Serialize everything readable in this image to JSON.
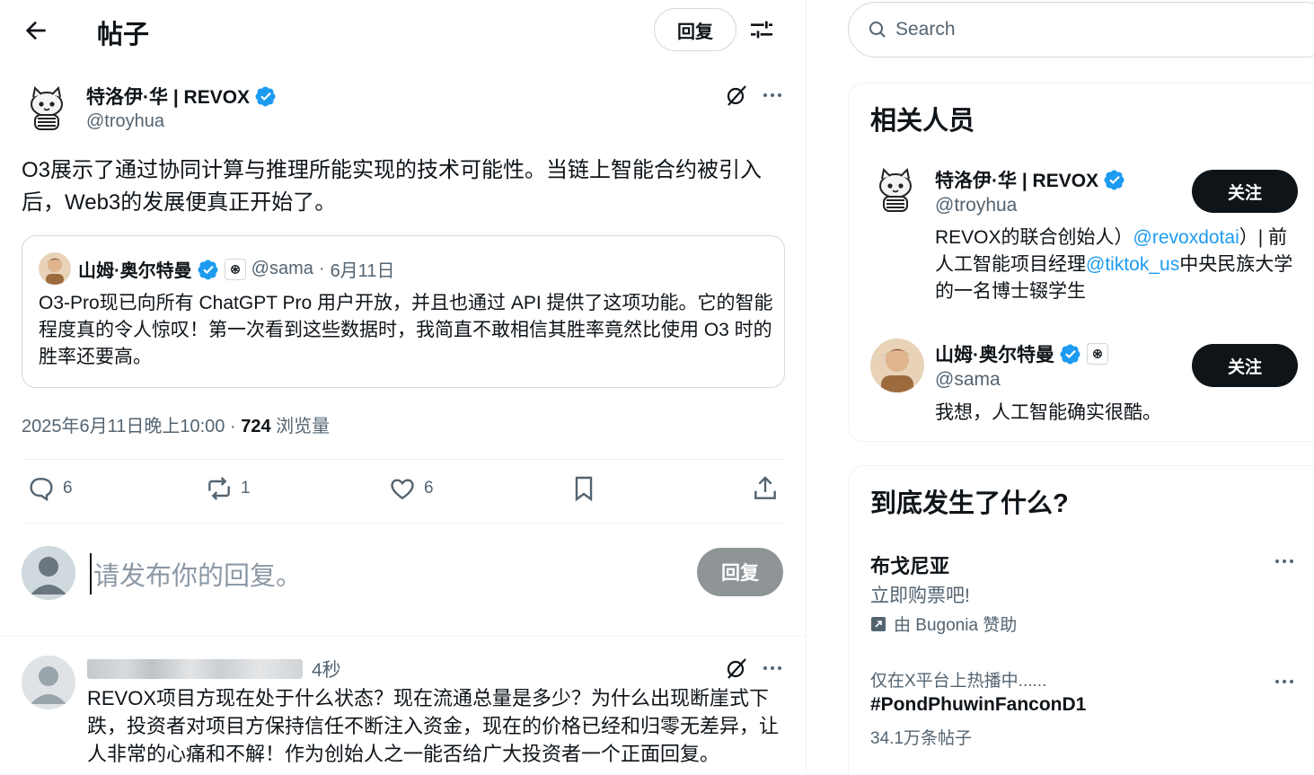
{
  "header": {
    "title": "帖子",
    "reply_button": "回复"
  },
  "post": {
    "author_name": "特洛伊·华 | REVOX",
    "author_handle": "@troyhua",
    "text": "O3展示了通过协同计算与推理所能实现的技术可能性。当链上智能合约被引入后，Web3的发展便真正开始了。",
    "quote": {
      "author_name": "山姆·奥尔特曼",
      "handle": "@sama",
      "separator": "·",
      "date": "6月11日",
      "text": "O3-Pro现已向所有 ChatGPT Pro 用户开放，并且也通过 API 提供了这项功能。它的智能程度真的令人惊叹！第一次看到这些数据时，我简直不敢相信其胜率竟然比使用 O3 时的胜率还要高。"
    },
    "timestamp": "2025年6月11日晚上10:00",
    "dot": "·",
    "views_count": "724",
    "views_label": "浏览量",
    "replies": "6",
    "reposts": "1",
    "likes": "6"
  },
  "compose": {
    "placeholder": "请发布你的回复。",
    "button": "回复"
  },
  "reply": {
    "time": "4秒",
    "text": "REVOX项目方现在处于什么状态？现在流通总量是多少？为什么出现断崖式下跌，投资者对项目方保持信任不断注入资金，现在的价格已经和归零无差异，让人非常的心痛和不解！作为创始人之一能否给广大投资者一个正面回复。"
  },
  "sidebar": {
    "search_placeholder": "Search",
    "relevant_title": "相关人员",
    "people": [
      {
        "name": "特洛伊·华 | REVOX",
        "handle": "@troyhua",
        "bio_1": "REVOX的联合创始人）",
        "bio_link_1": "@revoxdotai",
        "bio_2": "）| 前人工智能项目经理",
        "bio_link_2": "@tiktok_us",
        "bio_3": "中央民族大学的一名博士辍学生",
        "follow": "关注"
      },
      {
        "name": "山姆·奥尔特曼",
        "handle": "@sama",
        "bio": "我想，人工智能确实很酷。",
        "follow": "关注"
      }
    ],
    "trends_title": "到底发生了什么?",
    "trends": [
      {
        "name": "布戈尼亚",
        "sub": "立即购票吧!",
        "ad": "由 Bugonia 赞助"
      },
      {
        "context": "仅在X平台上热播中......",
        "tag": "#PondPhuwinFanconD1",
        "count": "34.1万条帖子"
      }
    ]
  },
  "colors": {
    "verified": "#1d9bf0",
    "link": "#1d9bf0",
    "follow_bg": "#0f1419",
    "reply_btn_disabled": "#8f9497"
  },
  "icons": [
    "back-arrow-icon",
    "adjust-icon",
    "grok-icon",
    "more-icon",
    "verified-icon",
    "openai-icon",
    "reply-icon",
    "repost-icon",
    "like-icon",
    "bookmark-icon",
    "share-icon",
    "search-icon",
    "ad-icon"
  ]
}
